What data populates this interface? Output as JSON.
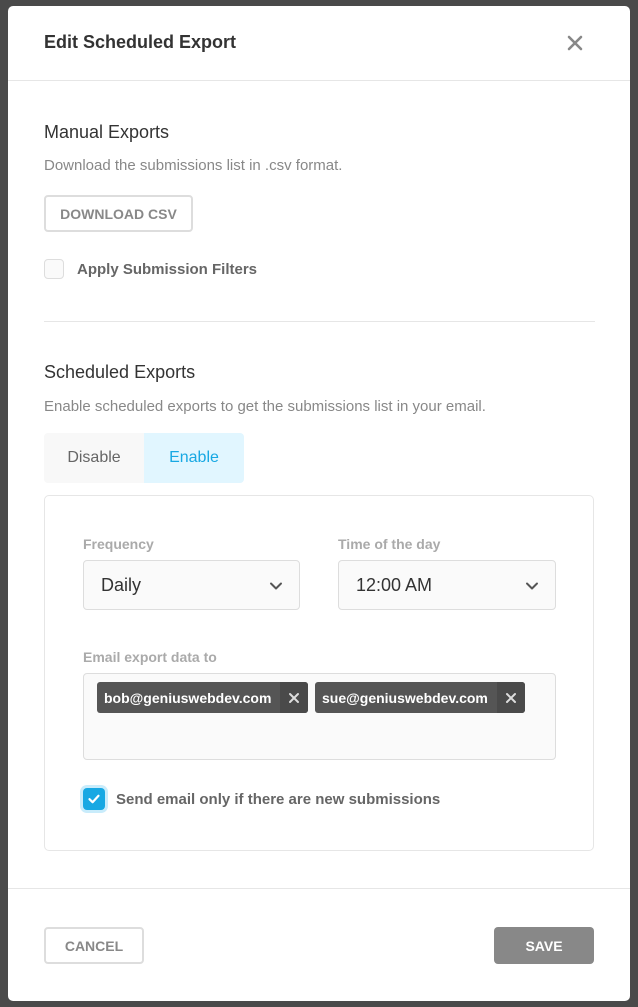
{
  "modal": {
    "title": "Edit Scheduled Export",
    "close_icon": "close-icon"
  },
  "manual": {
    "title": "Manual Exports",
    "description": "Download the submissions list in .csv format.",
    "download_label": "DOWNLOAD CSV",
    "apply_filters_label": "Apply Submission Filters",
    "apply_filters_checked": false
  },
  "scheduled": {
    "title": "Scheduled Exports",
    "description": "Enable scheduled exports to get the submissions list in your email.",
    "tabs": [
      {
        "label": "Disable",
        "active": false
      },
      {
        "label": "Enable",
        "active": true
      }
    ],
    "frequency_label": "Frequency",
    "frequency_value": "Daily",
    "time_label": "Time of the day",
    "time_value": "12:00 AM",
    "email_label": "Email export data to",
    "emails": [
      "bob@geniuswebdev.com",
      "sue@geniuswebdev.com"
    ],
    "new_only_label": "Send email only if there are new submissions",
    "new_only_checked": true
  },
  "footer": {
    "cancel_label": "CANCEL",
    "save_label": "SAVE"
  },
  "colors": {
    "accent": "#17a8e3",
    "accent_bg": "#e1f6ff",
    "chip_bg": "#555555",
    "save_bg": "#888888"
  }
}
